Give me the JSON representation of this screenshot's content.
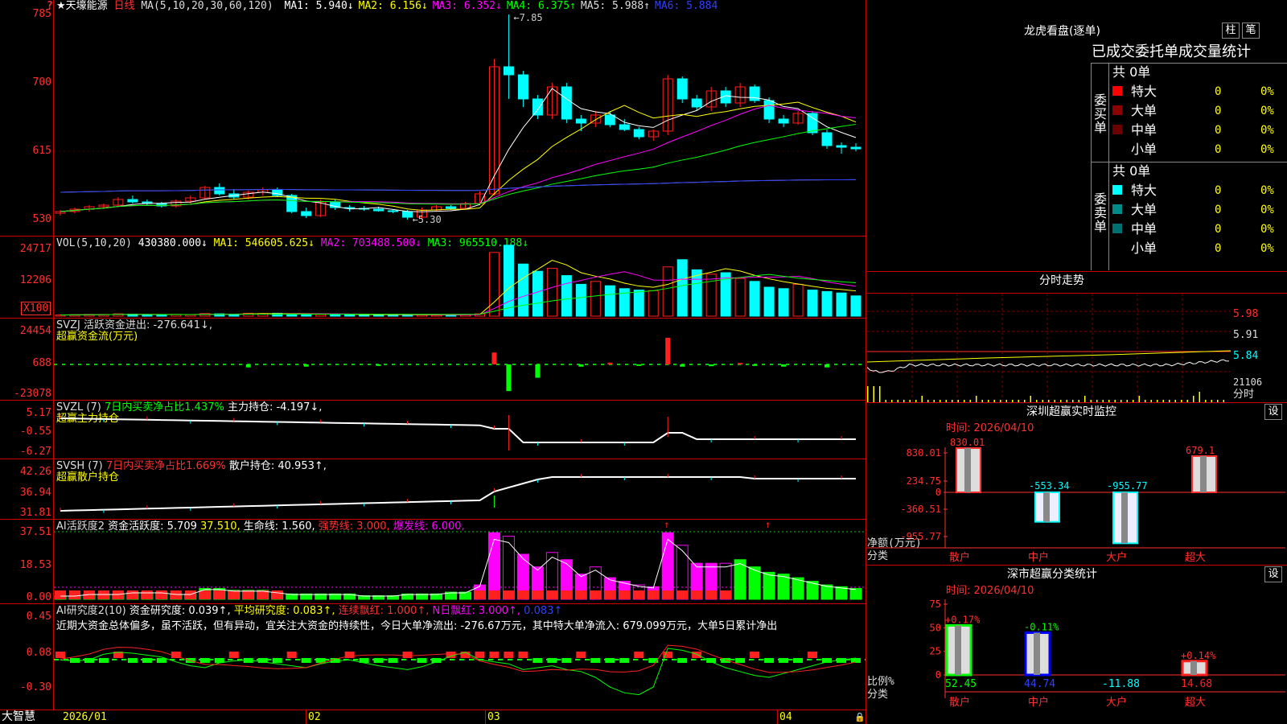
{
  "colors": {
    "up": "#ff2020",
    "down": "#00ffff",
    "grid": "#c00000",
    "ma1": "#ffffff",
    "ma2": "#ffff00",
    "ma3": "#ff00ff",
    "ma4": "#00ff00",
    "ma5": "#aaaaaa",
    "ma6": "#3040ff"
  },
  "corner_icon": "question-icon",
  "main": {
    "title": "★天壕能源",
    "period": "日线",
    "ma_spec": "MA(5,10,20,30,60,120)",
    "ma": [
      {
        "label": "MA1: 5.940↓",
        "color": "#ffffff"
      },
      {
        "label": "MA2: 6.156↓",
        "color": "#ffff00"
      },
      {
        "label": "MA3: 6.352↓",
        "color": "#ff00ff"
      },
      {
        "label": "MA4: 6.375↑",
        "color": "#00ff00"
      },
      {
        "label": "MA5: 5.988↑",
        "color": "#dddddd"
      },
      {
        "label": "MA6: 5.884",
        "color": "#3040ff"
      }
    ],
    "yticks": [
      "7.85",
      "7.00",
      "6.15",
      "5.30"
    ],
    "high_label": "7.85",
    "low_label": "5.30"
  },
  "vol": {
    "header": "VOL(5,10,20)",
    "value": "430380.000↓",
    "ma1": "MA1: 546605.625↓",
    "ma2": "MA2: 703488.500↓",
    "ma3": "MA3: 965510.188↓",
    "yticks": [
      "24717",
      "12206"
    ],
    "unit": "X100"
  },
  "svzj": {
    "line1": "SVZJ  活跃资金进出: -276.641↓,",
    "line2": "超赢资金流(万元)",
    "yticks": [
      "24454",
      "688",
      "-23078"
    ]
  },
  "svzl": {
    "name": "SVZL (7)",
    "pct": "7日内买卖净占比1.437%",
    "hold": "主力持仓: -4.197↓,",
    "line2": "超赢主力持仓",
    "yticks": [
      "5.17",
      "-0.55",
      "-6.27"
    ]
  },
  "svsh": {
    "name": "SVSH (7)",
    "pct": "7日内买卖净占比1.669%",
    "hold": "散户持仓: 40.953↑,",
    "line2": "超赢散户持仓",
    "yticks": [
      "42.26",
      "36.94",
      "31.81"
    ]
  },
  "ai1": {
    "name": "AI活跃度2",
    "a": "资金活跃度: 5.709",
    "b": "37.510,",
    "c": "生命线: 1.560,",
    "d": "强势线: 3.000,",
    "e": "爆发线: 6.000,",
    "yticks": [
      "37.51",
      "18.53",
      "0.00"
    ]
  },
  "ai2": {
    "name": "AI研究度2(10)",
    "a": "资金研究度: 0.039↑,",
    "b": "平均研究度: 0.083↑,",
    "c": "连续飘红: 1.000↑,",
    "d": "N日飘红: 3.000↑,",
    "e": "0.083↑",
    "comment": "近期大资金总体偏多，虽不活跃，但有异动，宜关注大资金的持续性，今日大单净流出: -276.67万元，其中特大单净流入: 679.099万元，大单5日累计净出",
    "yticks": [
      "0.45",
      "0.08",
      "-0.30"
    ]
  },
  "xaxis": {
    "brand": "大智慧",
    "labels": [
      "2026/01",
      "02",
      "03",
      "04"
    ]
  },
  "dragon": {
    "title": "龙虎看盘(逐单)",
    "btn1": "柱",
    "btn2": "笔",
    "stats_title": "已成交委托单成交量统计",
    "buy": {
      "side": "委买单",
      "total": "共 0单",
      "rows": [
        {
          "name": "特大",
          "n": "0",
          "p": "0%",
          "color": "#ff0000"
        },
        {
          "name": "大单",
          "n": "0",
          "p": "0%",
          "color": "#8b0000"
        },
        {
          "name": "中单",
          "n": "0",
          "p": "0%",
          "color": "#6b0000"
        },
        {
          "name": "小单",
          "n": "0",
          "p": "0%",
          "color": "#000000"
        }
      ]
    },
    "sell": {
      "side": "委卖单",
      "total": "共 0单",
      "rows": [
        {
          "name": "特大",
          "n": "0",
          "p": "0%",
          "color": "#00ffff"
        },
        {
          "name": "大单",
          "n": "0",
          "p": "0%",
          "color": "#008b8b"
        },
        {
          "name": "中单",
          "n": "0",
          "p": "0%",
          "color": "#007070"
        },
        {
          "name": "小单",
          "n": "0",
          "p": "0%",
          "color": "#000000"
        }
      ]
    }
  },
  "intraday": {
    "title": "分时走势",
    "yticks": [
      "5.98",
      "5.91",
      "5.84"
    ],
    "vol_tick": "21106",
    "vol_label": "分时"
  },
  "sz_monitor": {
    "title": "深圳超赢实时监控",
    "btn": "设",
    "date": "时间: 2026/04/10",
    "yticks": [
      "830.01",
      "234.75",
      "0",
      "-360.51",
      "-955.77"
    ],
    "ylabel": "净额(万元)",
    "xlabel": "分类",
    "bars": [
      {
        "cat": "散户",
        "value": 830.01,
        "label": "830.01"
      },
      {
        "cat": "中户",
        "value": -553.34,
        "label": "-553.34"
      },
      {
        "cat": "大户",
        "value": -955.77,
        "label": "-955.77"
      },
      {
        "cat": "超大",
        "value": 679.1,
        "label": "679.1"
      }
    ]
  },
  "sz_class": {
    "title": "深市超赢分类统计",
    "btn": "设",
    "date": "时间: 2026/04/10",
    "yticks": [
      "75",
      "50",
      "25",
      "0"
    ],
    "ylabel": "比例%",
    "xlabel": "分类",
    "bars": [
      {
        "cat": "散户",
        "ratio": 52.45,
        "change": "+0.17%",
        "ratio_label": "52.45"
      },
      {
        "cat": "中户",
        "ratio": 44.74,
        "change": "-0.11%",
        "ratio_label": "44.74"
      },
      {
        "cat": "大户",
        "ratio": -11.88,
        "change": "",
        "ratio_label": "-11.88"
      },
      {
        "cat": "超大",
        "ratio": 14.68,
        "change": "+0.14%",
        "ratio_label": "14.68"
      }
    ]
  },
  "chart_data": [
    {
      "type": "candlestick",
      "title": "天壕能源 日线",
      "ylim": [
        5.2,
        7.95
      ],
      "ohlc": [
        [
          5.38,
          5.42,
          5.35,
          5.4
        ],
        [
          5.4,
          5.45,
          5.38,
          5.43
        ],
        [
          5.43,
          5.48,
          5.4,
          5.46
        ],
        [
          5.46,
          5.5,
          5.44,
          5.48
        ],
        [
          5.48,
          5.58,
          5.46,
          5.55
        ],
        [
          5.55,
          5.6,
          5.5,
          5.52
        ],
        [
          5.52,
          5.55,
          5.48,
          5.5
        ],
        [
          5.5,
          5.52,
          5.45,
          5.47
        ],
        [
          5.47,
          5.55,
          5.45,
          5.53
        ],
        [
          5.53,
          5.6,
          5.5,
          5.57
        ],
        [
          5.57,
          5.72,
          5.55,
          5.7
        ],
        [
          5.7,
          5.75,
          5.6,
          5.62
        ],
        [
          5.62,
          5.68,
          5.55,
          5.58
        ],
        [
          5.58,
          5.66,
          5.55,
          5.64
        ],
        [
          5.64,
          5.7,
          5.6,
          5.67
        ],
        [
          5.67,
          5.7,
          5.58,
          5.6
        ],
        [
          5.6,
          5.62,
          5.38,
          5.4
        ],
        [
          5.4,
          5.45,
          5.32,
          5.35
        ],
        [
          5.35,
          5.55,
          5.33,
          5.52
        ],
        [
          5.52,
          5.55,
          5.42,
          5.45
        ],
        [
          5.45,
          5.48,
          5.4,
          5.44
        ],
        [
          5.44,
          5.47,
          5.41,
          5.43
        ],
        [
          5.43,
          5.46,
          5.4,
          5.41
        ],
        [
          5.41,
          5.43,
          5.38,
          5.4
        ],
        [
          5.4,
          5.42,
          5.3,
          5.33
        ],
        [
          5.33,
          5.45,
          5.3,
          5.42
        ],
        [
          5.42,
          5.48,
          5.4,
          5.46
        ],
        [
          5.46,
          5.48,
          5.42,
          5.44
        ],
        [
          5.44,
          5.52,
          5.43,
          5.5
        ],
        [
          5.5,
          5.65,
          5.48,
          5.62
        ],
        [
          5.62,
          7.3,
          5.6,
          7.2
        ],
        [
          7.2,
          7.85,
          6.8,
          7.1
        ],
        [
          7.1,
          7.15,
          6.7,
          6.8
        ],
        [
          6.8,
          6.85,
          6.55,
          6.6
        ],
        [
          6.6,
          7.0,
          6.55,
          6.95
        ],
        [
          6.95,
          7.0,
          6.5,
          6.55
        ],
        [
          6.55,
          6.6,
          6.4,
          6.5
        ],
        [
          6.5,
          6.65,
          6.45,
          6.6
        ],
        [
          6.6,
          6.65,
          6.45,
          6.48
        ],
        [
          6.48,
          6.55,
          6.4,
          6.42
        ],
        [
          6.42,
          6.45,
          6.3,
          6.33
        ],
        [
          6.33,
          6.42,
          6.28,
          6.4
        ],
        [
          6.4,
          7.1,
          6.35,
          7.05
        ],
        [
          7.05,
          7.08,
          6.75,
          6.8
        ],
        [
          6.8,
          6.85,
          6.65,
          6.7
        ],
        [
          6.7,
          6.95,
          6.65,
          6.9
        ],
        [
          6.9,
          6.95,
          6.7,
          6.75
        ],
        [
          6.75,
          7.0,
          6.7,
          6.95
        ],
        [
          6.95,
          6.98,
          6.75,
          6.78
        ],
        [
          6.78,
          6.82,
          6.5,
          6.55
        ],
        [
          6.55,
          6.6,
          6.45,
          6.5
        ],
        [
          6.5,
          6.65,
          6.48,
          6.62
        ],
        [
          6.62,
          6.65,
          6.35,
          6.38
        ],
        [
          6.38,
          6.42,
          6.18,
          6.22
        ],
        [
          6.22,
          6.26,
          6.12,
          6.2
        ],
        [
          6.2,
          6.25,
          6.15,
          6.18
        ]
      ]
    },
    {
      "type": "bar",
      "title": "VOL(5,10,20)",
      "values": [
        4,
        5,
        6,
        6,
        8,
        7,
        5,
        4,
        6,
        5,
        9,
        8,
        7,
        10,
        9,
        10,
        8,
        7,
        6,
        5,
        6,
        4,
        5,
        4,
        5,
        5,
        4,
        5,
        6,
        8,
        220,
        245,
        180,
        155,
        165,
        140,
        110,
        120,
        105,
        95,
        90,
        88,
        170,
        195,
        160,
        145,
        150,
        130,
        120,
        100,
        95,
        110,
        90,
        85,
        80,
        70
      ]
    },
    {
      "type": "bar",
      "title": "超赢资金流(万元)",
      "ylim": [
        -23078,
        24454
      ],
      "values": [
        0,
        0,
        0,
        0,
        0,
        0,
        0,
        0,
        0,
        0,
        0,
        0,
        0,
        -2000,
        0,
        0,
        0,
        -1500,
        0,
        0,
        0,
        0,
        -1000,
        0,
        0,
        0,
        0,
        0,
        0,
        0,
        8000,
        -18000,
        0,
        -9000,
        0,
        0,
        -1500,
        0,
        1200,
        0,
        -1000,
        0,
        18000,
        -1500,
        0,
        -1200,
        0,
        1000,
        -1000,
        0,
        -1500,
        0,
        0,
        -2000,
        0,
        0
      ]
    }
  ]
}
